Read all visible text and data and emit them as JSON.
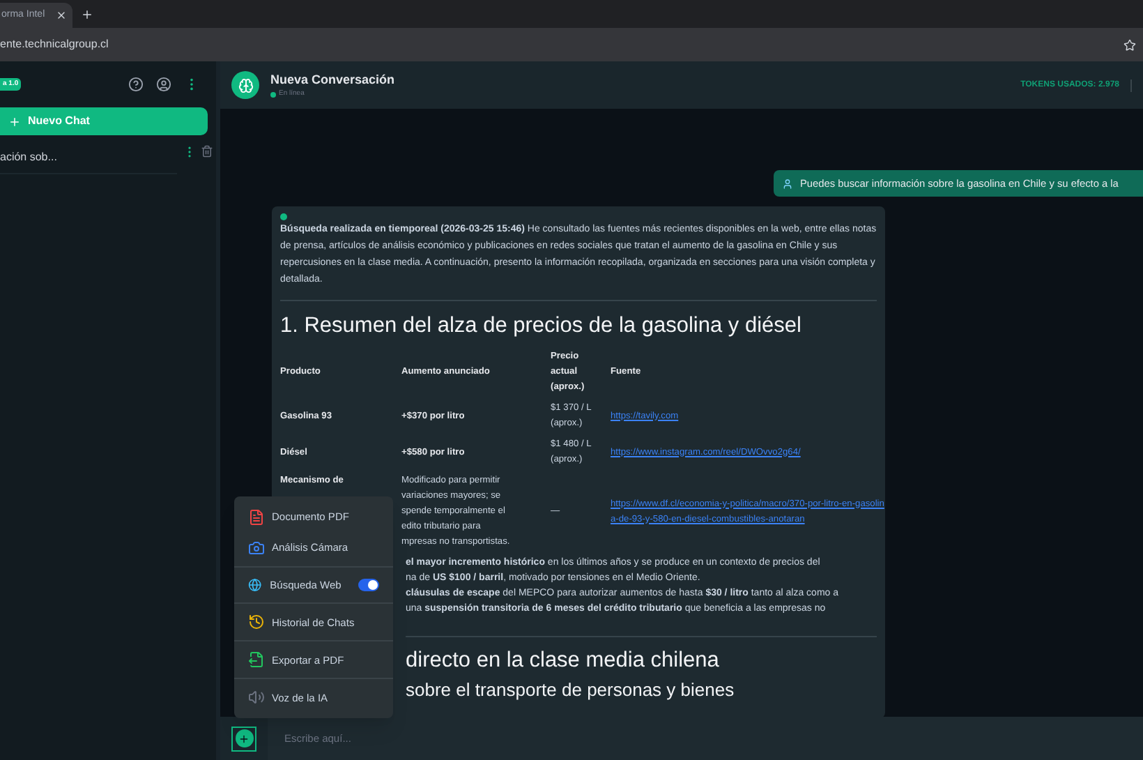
{
  "browser": {
    "tab_title": "orma Intel",
    "url": "ente.technicalgroup.cl"
  },
  "sidebar": {
    "badge": "a 1.0",
    "new_chat": "Nuevo Chat",
    "chats": [
      {
        "title": "ación sob..."
      }
    ]
  },
  "header": {
    "title": "Nueva Conversación",
    "status": "En línea",
    "tokens": "TOKENS USADOS: 2.978"
  },
  "user_message": "Puedes buscar información sobre la gasolina en Chile y su efecto a la",
  "answer": {
    "intro": "**Búsqueda realizada en tiemporeal (2026-03-25 15:46)** He consultado las fuentes más recientes disponibles en la web, entre ellas notas de prensa, artículos de análisis económico y publicaciones en redes sociales que tratan el aumento de la gasolina en Chile y sus repercusiones en la clase media. A continuación, presento la información recopilada, organizada en secciones para una visión completa y detallada.",
    "heading": "1. Resumen del alza de precios de la gasolina y diésel",
    "columns": [
      "Producto",
      "Aumento anunciado",
      "Precio actual (aprox.)",
      "Fuente"
    ],
    "rows": [
      {
        "product": "Gasolina 93",
        "increase": [
          "+$370 por litro"
        ],
        "price": "$1 370 / L (aprox.)",
        "source": "https://tavily.com"
      },
      {
        "product": "Diésel",
        "increase": [
          "+$580 por litro"
        ],
        "price": "$1 480 / L (aprox.)",
        "source": "https://www.instagram.com/reel/DWOvvo2g64/"
      },
      {
        "product": "Mecanismo de",
        "increase": [
          "Modificado para permitir",
          "variaciones mayores; se",
          "spende temporalmente el",
          "edito tributario para",
          "mpresas no transportistas."
        ],
        "price": "—",
        "source": "https://www.df.cl/economia-y-politica/macro/370-por-litro-en-gasolina-de-93-y-580-en-diesel-combustibles-anotaran"
      }
    ],
    "notes": [
      "**el mayor incremento histórico** en los últimos años y se produce en un contexto de precios del",
      "na de **US $100 / barril**, motivado por tensiones en el Medio Oriente.",
      "**cláusulas de escape** del MEPCO para autorizar aumentos de hasta **$30 / litro** tanto al alza como a",
      "una **suspensión transitoria de 6 meses del crédito tributario** que beneficia a las empresas no"
    ],
    "heading_2": "directo en la clase media chilena",
    "heading_3": "sobre el transporte de personas y bienes"
  },
  "menu": {
    "groups": [
      [
        {
          "kind": "item",
          "label": "Documento PDF"
        },
        {
          "kind": "item",
          "label": "Análisis Cámara"
        }
      ],
      [
        {
          "kind": "toggle",
          "label": "Búsqueda Web",
          "on": true
        }
      ],
      [
        {
          "kind": "item",
          "label": "Historial de Chats"
        }
      ],
      [
        {
          "kind": "item",
          "label": "Exportar a PDF"
        }
      ],
      [
        {
          "kind": "item",
          "label": "Voz de la IA"
        }
      ]
    ]
  },
  "composer": {
    "placeholder": "Escribe aquí..."
  }
}
